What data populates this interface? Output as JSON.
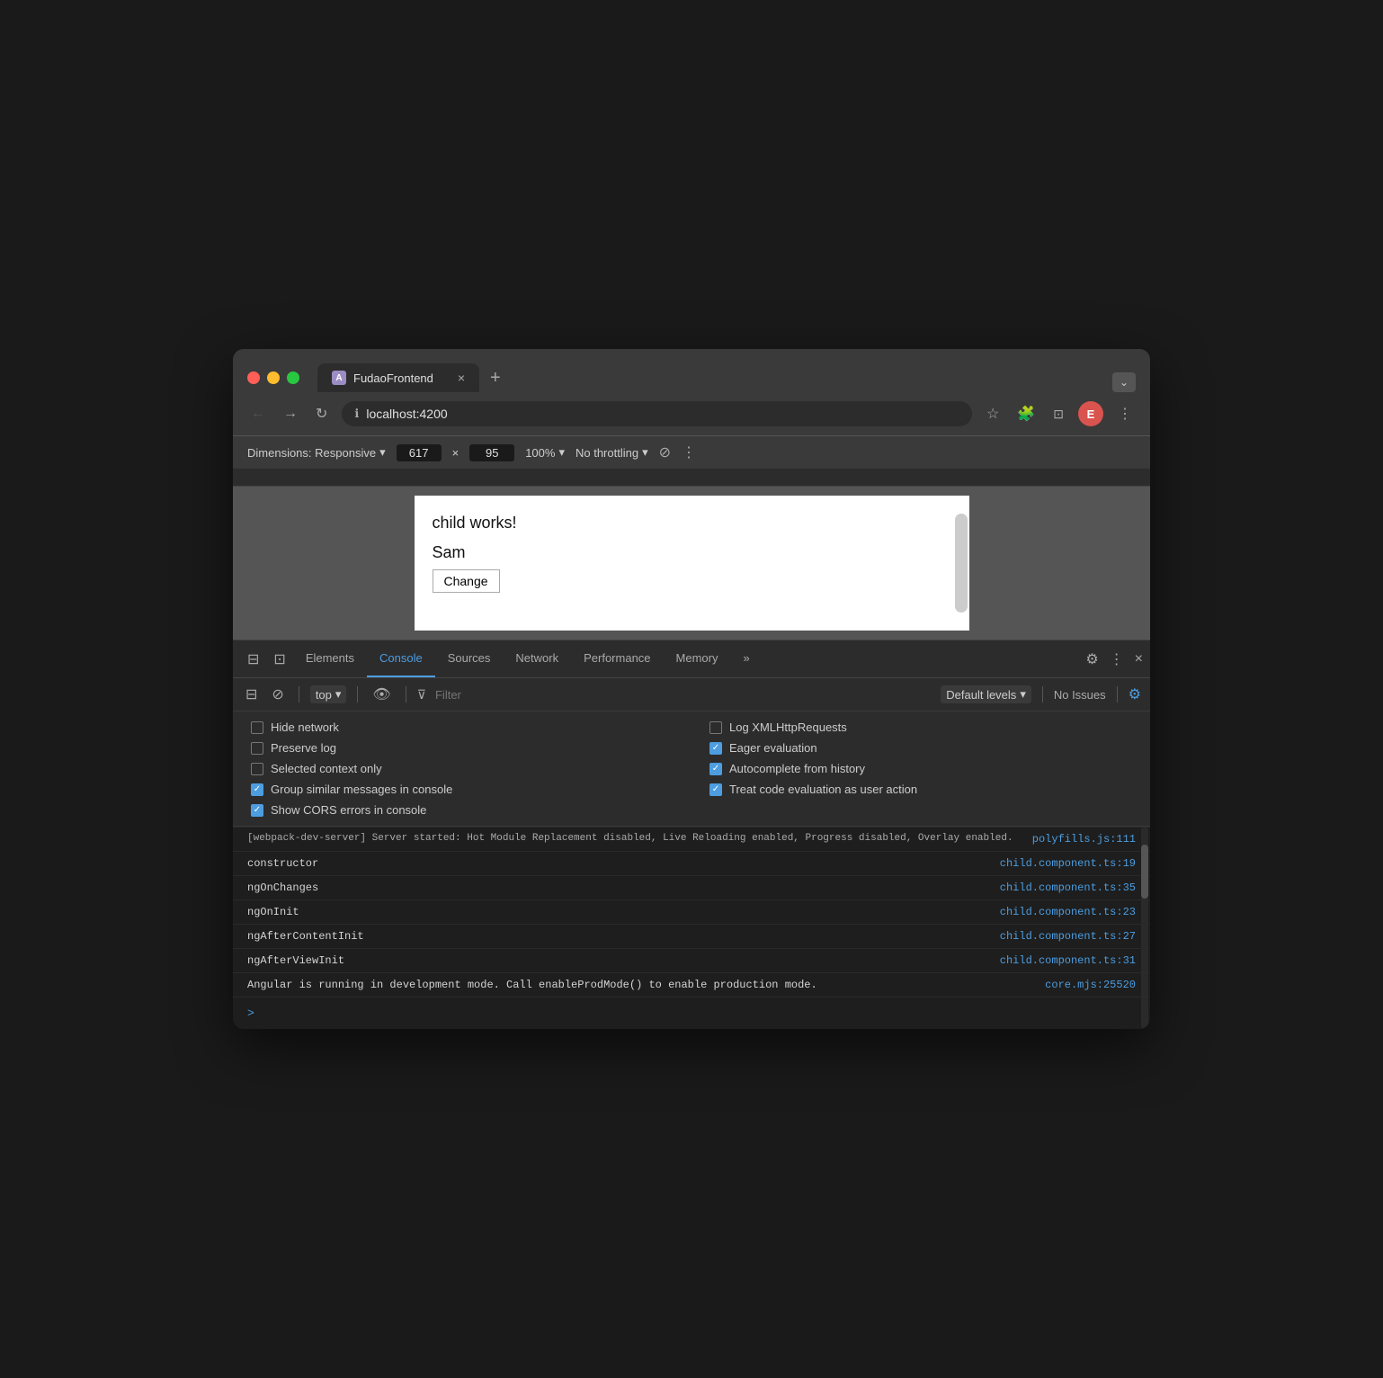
{
  "browser": {
    "title": "FudaoFrontend",
    "url": "localhost:4200",
    "tab_close": "×",
    "tab_new": "+",
    "tab_menu": "⌄",
    "tab_icon_label": "A"
  },
  "nav": {
    "back": "←",
    "forward": "→",
    "refresh": "↻",
    "star": "☆",
    "extensions": "🧩",
    "cast": "⊡",
    "user": "E",
    "more": "⋮"
  },
  "devtools_bar": {
    "dimensions_label": "Dimensions: Responsive",
    "dimensions_arrow": "▾",
    "width": "617",
    "times": "×",
    "height": "95",
    "zoom": "100%",
    "zoom_arrow": "▾",
    "throttle": "No throttling",
    "throttle_arrow": "▾",
    "rotate": "⊘",
    "more": "⋮"
  },
  "page": {
    "main_text": "child works!",
    "name_text": "Sam",
    "button_label": "Change"
  },
  "devtools_tabs": {
    "items": [
      {
        "label": "Elements",
        "active": false
      },
      {
        "label": "Console",
        "active": true
      },
      {
        "label": "Sources",
        "active": false
      },
      {
        "label": "Network",
        "active": false
      },
      {
        "label": "Performance",
        "active": false
      },
      {
        "label": "Memory",
        "active": false
      },
      {
        "label": "»",
        "active": false
      }
    ],
    "settings_icon": "⚙",
    "more_icon": "⋮",
    "close_icon": "×"
  },
  "devtools_toolbar": {
    "sidebar_icon": "⊟",
    "ban_icon": "⊘",
    "context_label": "top",
    "context_arrow": "▾",
    "eye_icon": "👁",
    "filter_placeholder": "Filter",
    "filter_icon": "⊽",
    "levels_label": "Default levels",
    "levels_arrow": "▾",
    "no_issues": "No Issues",
    "settings_icon": "⚙"
  },
  "console_settings": {
    "items": [
      {
        "label": "Hide network",
        "checked": false,
        "side": "left"
      },
      {
        "label": "Log XMLHttpRequests",
        "checked": false,
        "side": "right"
      },
      {
        "label": "Preserve log",
        "checked": false,
        "side": "left"
      },
      {
        "label": "Eager evaluation",
        "checked": true,
        "side": "right"
      },
      {
        "label": "Selected context only",
        "checked": false,
        "side": "left"
      },
      {
        "label": "Autocomplete from history",
        "checked": true,
        "side": "right"
      },
      {
        "label": "Group similar messages in console",
        "checked": true,
        "side": "left"
      },
      {
        "label": "Treat code evaluation as user action",
        "checked": true,
        "side": "right"
      },
      {
        "label": "Show CORS errors in console",
        "checked": true,
        "side": "left"
      }
    ]
  },
  "console_messages": [
    {
      "text": "[webpack-dev-server] Server started: Hot Module Replacement disabled, Live Reloading enabled, Progress disabled, Overlay enabled.",
      "link": "polyfills.js",
      "link_full": "polyfills.js:111"
    },
    {
      "text": "constructor",
      "link": "child.component.ts:19",
      "link_full": "child.component.ts:19"
    },
    {
      "text": "ngOnChanges",
      "link": "child.component.ts:35",
      "link_full": "child.component.ts:35"
    },
    {
      "text": "ngOnInit",
      "link": "child.component.ts:23",
      "link_full": "child.component.ts:23"
    },
    {
      "text": "ngAfterContentInit",
      "link": "child.component.ts:27",
      "link_full": "child.component.ts:27"
    },
    {
      "text": "ngAfterViewInit",
      "link": "child.component.ts:31",
      "link_full": "child.component.ts:31"
    },
    {
      "text": "Angular is running in development mode. Call enableProdMode() to enable production mode.",
      "link": "core.mjs:25520",
      "link_full": "core.mjs:25520"
    }
  ],
  "console_prompt": ">"
}
